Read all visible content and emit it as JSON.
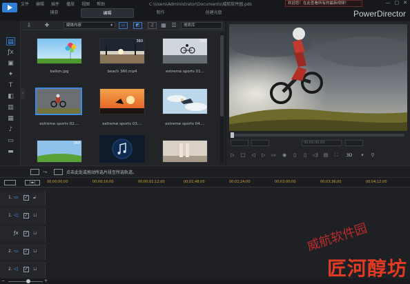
{
  "menu": [
    "文件",
    "编辑",
    "插件",
    "播放",
    "视图",
    "帮助"
  ],
  "mode_tabs": [
    "捕获",
    "编辑",
    "制作",
    "创建光盘"
  ],
  "file_path": "C:\\Users\\Administrator\\Documents\\威航软件园.pds",
  "notice": "欢迎您！在此查看所有的最新视频！",
  "brand": "PowerDirector",
  "window_buttons": [
    "—",
    "□",
    "✕"
  ],
  "rail_icons": [
    "media-icon",
    "fx-icon",
    "pip-icon",
    "particle-icon",
    "title-icon",
    "transition-icon",
    "subtitle-icon",
    "audio-mix-icon",
    "voice-icon",
    "chapter-icon",
    "subtitle-room-icon"
  ],
  "library": {
    "filter_label": "媒体内容",
    "search_placeholder": "搜索库",
    "items": [
      {
        "name": "ballon.jpg",
        "kind": "balloon"
      },
      {
        "name": "beach 360.mp4",
        "kind": "beach",
        "badge": "360"
      },
      {
        "name": "extreme sports 01...",
        "kind": "bike1",
        "badge": "360"
      },
      {
        "name": "extreme sports 02....",
        "kind": "moto",
        "selected": true
      },
      {
        "name": "extreme sports 03....",
        "kind": "sunset"
      },
      {
        "name": "extreme sports 04....",
        "kind": "sky"
      },
      {
        "name": "",
        "kind": "field",
        "badge": "360"
      },
      {
        "name": "",
        "kind": "music"
      },
      {
        "name": "",
        "kind": "run"
      }
    ]
  },
  "preview": {
    "time_field": "00;00;00;00",
    "controls": [
      "play",
      "stop",
      "prev-frame",
      "next-frame",
      "snapshot",
      "mark-in",
      "mark-out",
      "volume",
      "3D"
    ],
    "mode_label": "3D"
  },
  "midbar": {
    "hint": "点击此处或拖动所选片段至所选轨道。"
  },
  "timeline": {
    "ruler": [
      "00;00;00;00",
      "00;00;16;00",
      "00;00;01;12;00",
      "00;01;48;00",
      "00;02;24;00",
      "00;03;00;00",
      "00;03;36;00",
      "00;04;12;00"
    ],
    "tracks": [
      {
        "num": "1.",
        "icon": "video-icon",
        "glyph": "▭"
      },
      {
        "num": "1.",
        "icon": "audio-icon",
        "glyph": "◁"
      },
      {
        "num": "",
        "icon": "fx-track-icon",
        "glyph": "ƒx"
      },
      {
        "num": "2.",
        "icon": "video-icon",
        "glyph": "▭"
      },
      {
        "num": "2.",
        "icon": "audio-icon",
        "glyph": "◁"
      }
    ]
  },
  "watermarks": {
    "diag": "威航软件园",
    "corner": "匠河醇坊"
  }
}
